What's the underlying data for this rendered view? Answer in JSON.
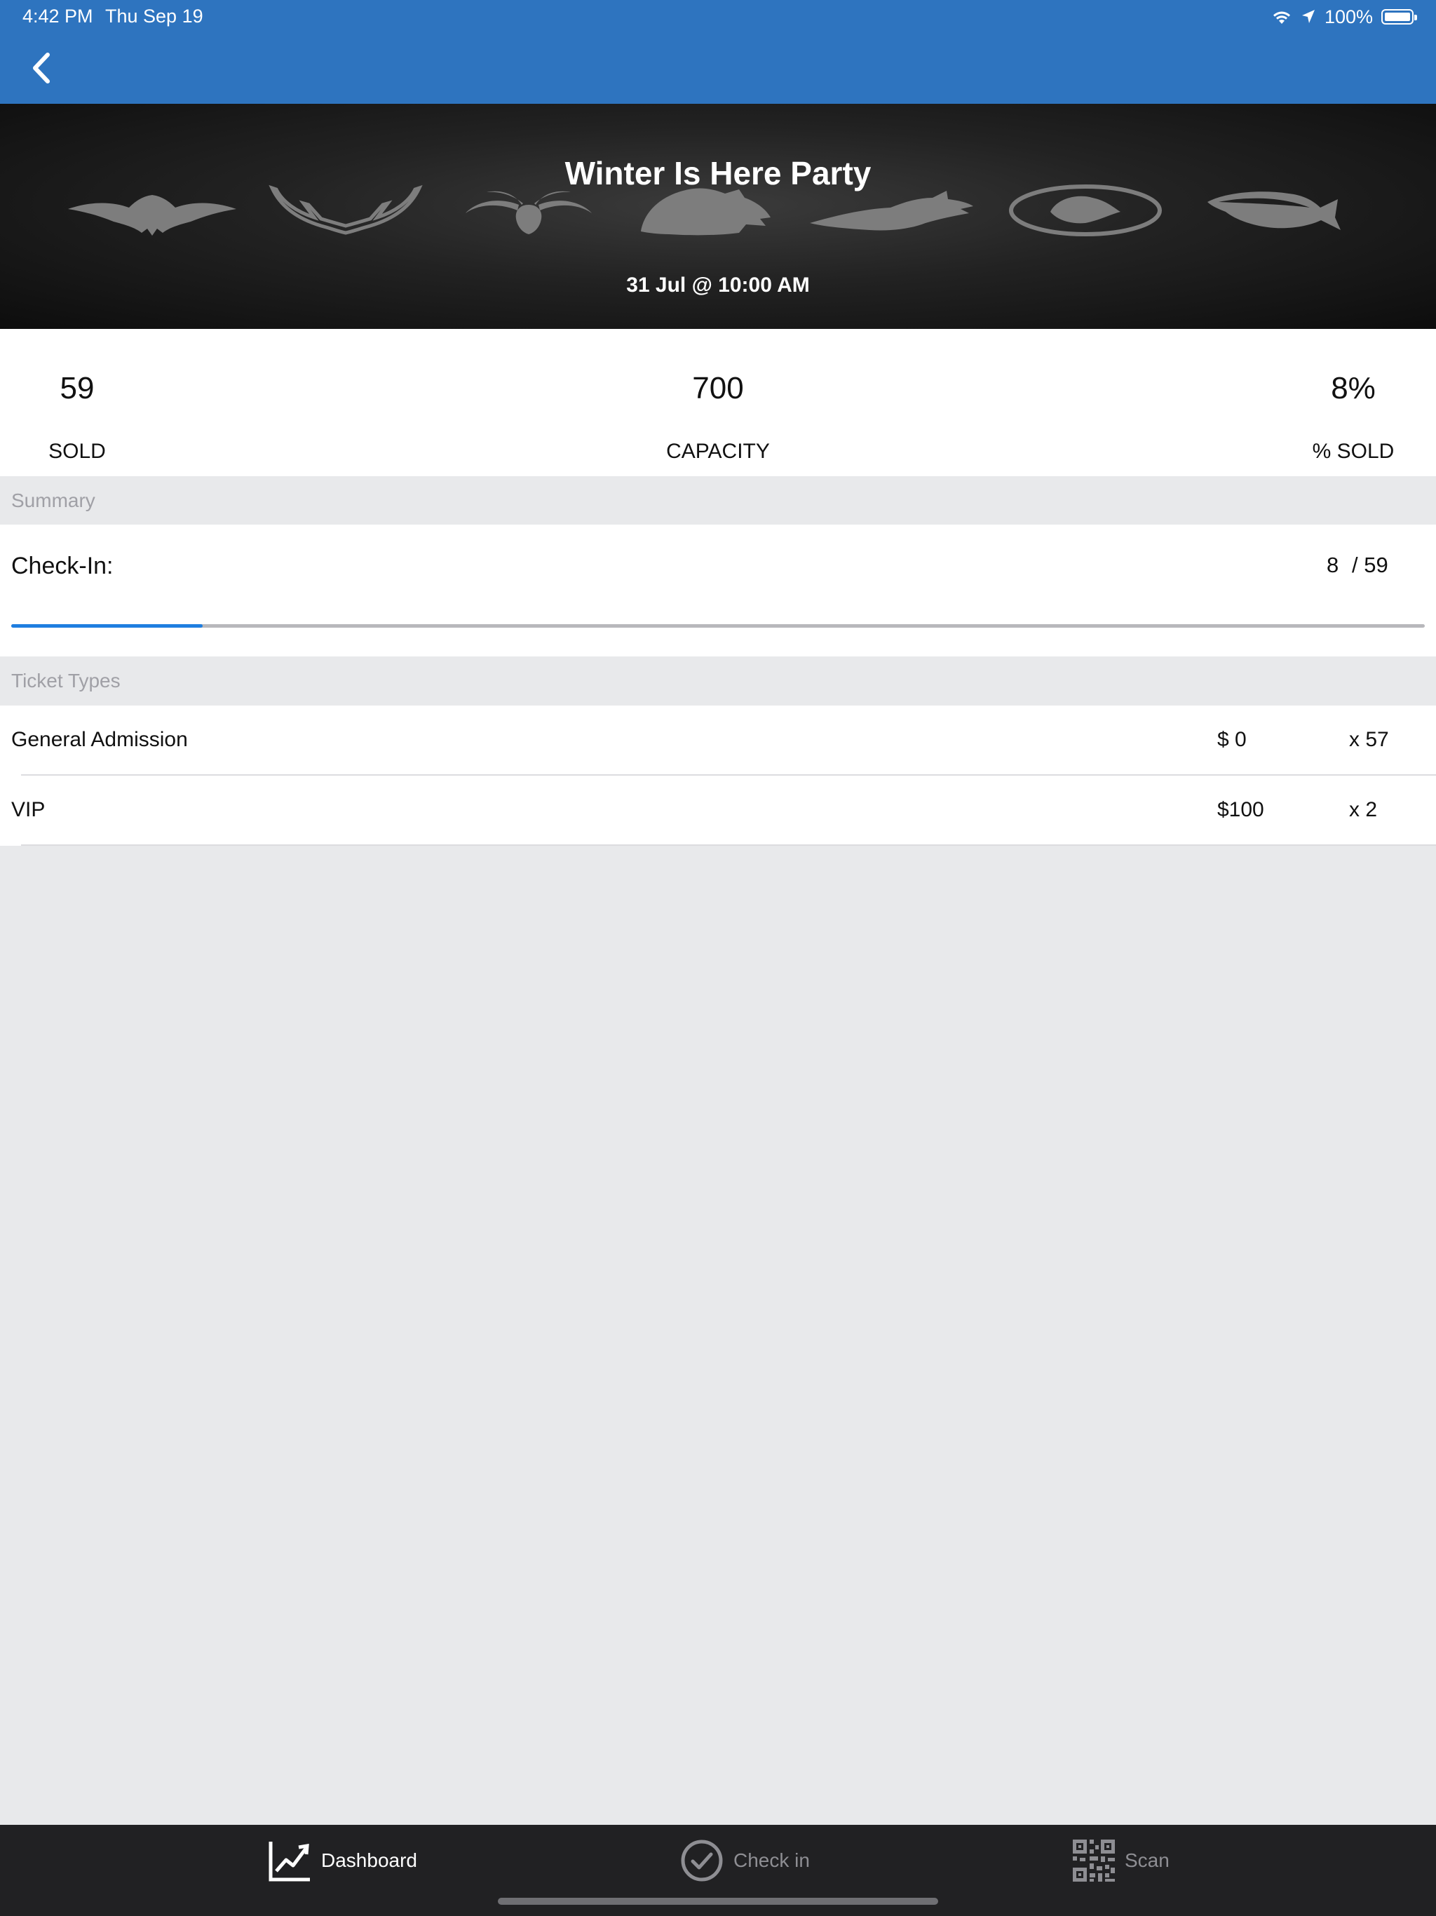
{
  "status_bar": {
    "time": "4:42 PM",
    "date": "Thu Sep 19",
    "battery": "100%"
  },
  "colors": {
    "nav_blue": "#2e74bf",
    "progress_blue": "#1f7ee0",
    "tabbar": "#212123"
  },
  "event": {
    "title": "Winter Is Here Party",
    "date": "31 Jul @ 10:00 AM"
  },
  "stats": {
    "sold": {
      "value": "59",
      "label": "SOLD"
    },
    "capacity": {
      "value": "700",
      "label": "CAPACITY"
    },
    "percent": {
      "value": "8%",
      "label": "% SOLD"
    }
  },
  "summary": {
    "header": "Summary",
    "checkin_label": "Check-In:",
    "checked_in": "8",
    "total": "/ 59",
    "progress_fraction": 0.1356
  },
  "ticket_types": {
    "header": "Ticket Types",
    "items": [
      {
        "name": "General Admission",
        "price": "$ 0",
        "qty": "x 57"
      },
      {
        "name": "VIP",
        "price": "$100",
        "qty": "x 2"
      }
    ]
  },
  "tabs": {
    "dashboard": "Dashboard",
    "checkin": "Check in",
    "scan": "Scan"
  }
}
